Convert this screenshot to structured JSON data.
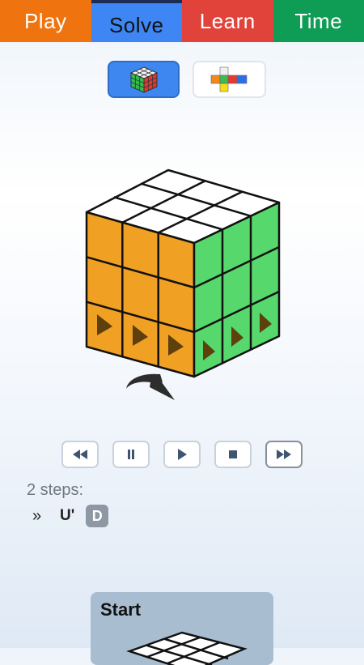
{
  "tabs": [
    {
      "label": "Play"
    },
    {
      "label": "Solve",
      "active": true
    },
    {
      "label": "Learn"
    },
    {
      "label": "Time"
    }
  ],
  "view_modes": {
    "selected": "3d-cube",
    "options": [
      {
        "icon": "cube-3d-icon"
      },
      {
        "icon": "cube-net-icon"
      }
    ]
  },
  "cube": {
    "faces": {
      "top": "white",
      "front": "orange",
      "right": "green"
    },
    "arrow": "rotate-bottom-layer",
    "colors": {
      "white": "#ffffff",
      "orange": "#f0a022",
      "green": "#57d86c",
      "marker": "#5e3f0e"
    }
  },
  "playback": {
    "buttons": [
      "rewind-icon",
      "pause-icon",
      "play-icon",
      "stop-icon",
      "fast-forward-icon"
    ]
  },
  "solution": {
    "steps_label": "2 steps:",
    "pointer": "»",
    "moves": [
      "U'",
      "D"
    ],
    "current_move_index": 1
  },
  "start_card": {
    "title": "Start"
  }
}
